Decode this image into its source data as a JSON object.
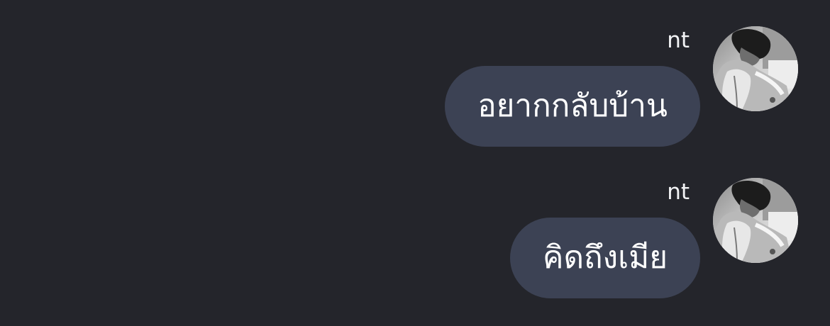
{
  "conversation": {
    "messages": [
      {
        "sender": "nt",
        "text": "อยากกลับบ้าน",
        "avatar_icon": "profile-photo-grayscale"
      },
      {
        "sender": "nt",
        "text": "คิดถึงเมีย",
        "avatar_icon": "profile-photo-grayscale"
      }
    ]
  },
  "colors": {
    "background": "#24252b",
    "bubble": "#3c4254",
    "text": "#ffffff"
  }
}
